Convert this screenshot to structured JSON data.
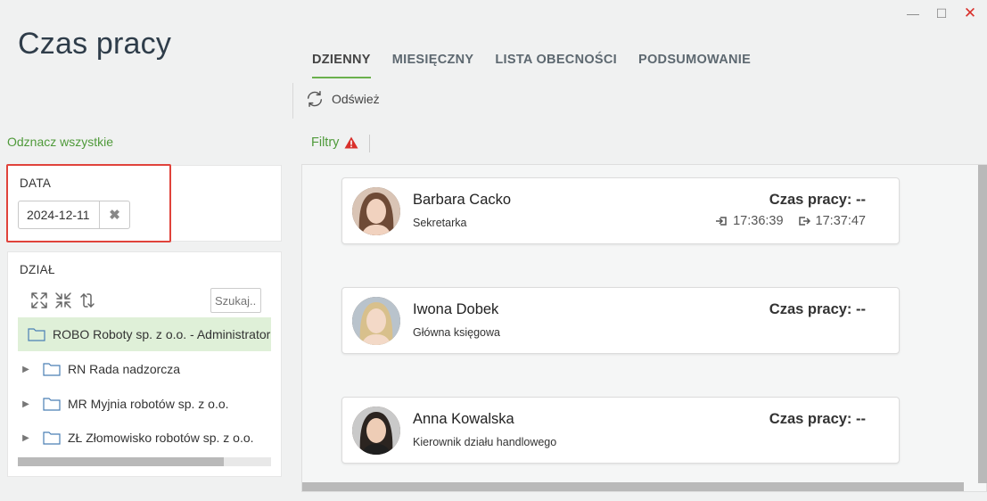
{
  "window": {
    "minimize_glyph": "—",
    "maximize_glyph": "☐",
    "close_glyph": "✕"
  },
  "app": {
    "title": "Czas pracy"
  },
  "tabs": [
    {
      "label": "DZIENNY",
      "active": true
    },
    {
      "label": "MIESIĘCZNY",
      "active": false
    },
    {
      "label": "LISTA OBECNOŚCI",
      "active": false
    },
    {
      "label": "PODSUMOWANIE",
      "active": false
    }
  ],
  "toolbar": {
    "refresh_label": "Odśwież",
    "refresh_icon": "refresh-icon"
  },
  "sidebar": {
    "select_all": "Odznacz wszystkie",
    "date": {
      "label": "DATA",
      "value": "2024-12-11",
      "clear_glyph": "✖"
    },
    "department": {
      "label": "DZIAŁ",
      "search_placeholder": "Szukaj...",
      "tools": [
        "expand-all-icon",
        "collapse-all-icon",
        "sync-icon"
      ],
      "items": [
        {
          "label": "ROBO Roboty sp. z o.o. - Administrator",
          "selected": true,
          "expandable": false
        },
        {
          "label": "RN Rada nadzorcza",
          "selected": false,
          "expandable": true
        },
        {
          "label": "MR Myjnia robotów sp. z o.o.",
          "selected": false,
          "expandable": true
        },
        {
          "label": "ZŁ Złomowisko robotów sp. z o.o.",
          "selected": false,
          "expandable": true
        }
      ]
    }
  },
  "filters": {
    "label": "Filtry",
    "warning_icon": "warning-icon",
    "accent": "#4f9a3a",
    "warning_color": "#d9302b"
  },
  "employees": [
    {
      "name": "Barbara Cacko",
      "role": "Sekretarka",
      "work_time": "Czas pracy: --",
      "clock_in": "17:36:39",
      "clock_out": "17:37:47"
    },
    {
      "name": "Iwona Dobek",
      "role": "Główna księgowa",
      "work_time": "Czas pracy: --"
    },
    {
      "name": "Anna Kowalska",
      "role": "Kierownik działu handlowego",
      "work_time": "Czas pracy: --"
    }
  ]
}
